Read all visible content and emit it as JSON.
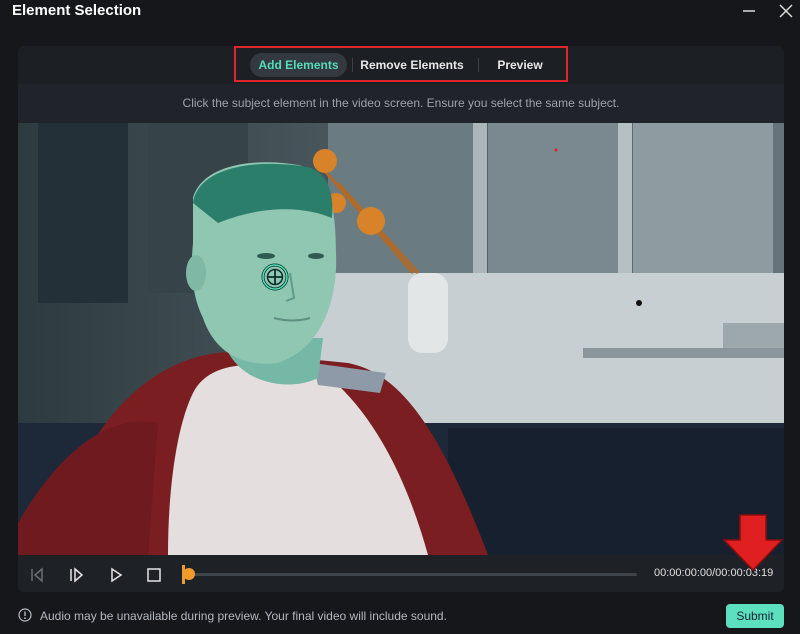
{
  "window": {
    "title": "Element Selection"
  },
  "tabs": [
    {
      "label": "Add Elements",
      "active": true
    },
    {
      "label": "Remove Elements",
      "active": false
    },
    {
      "label": "Preview",
      "active": false
    }
  ],
  "instruction": "Click the subject element in the video screen. Ensure you select the same subject.",
  "player": {
    "timecode": "00:00:00:00/00:00:03:19",
    "progress": 0
  },
  "footer": {
    "note": "Audio may be unavailable during preview. Your final video will include sound.",
    "submit_label": "Submit"
  },
  "colors": {
    "accent": "#5de0bd",
    "highlight_box": "#e0262c",
    "playhead": "#f19b2c",
    "selection_mask": "#3fbfa0"
  },
  "icons": [
    "minimize-icon",
    "close-icon",
    "prev-frame-icon",
    "next-frame-icon",
    "play-icon",
    "stop-icon",
    "info-icon",
    "crosshair-icon",
    "down-arrow-icon"
  ]
}
